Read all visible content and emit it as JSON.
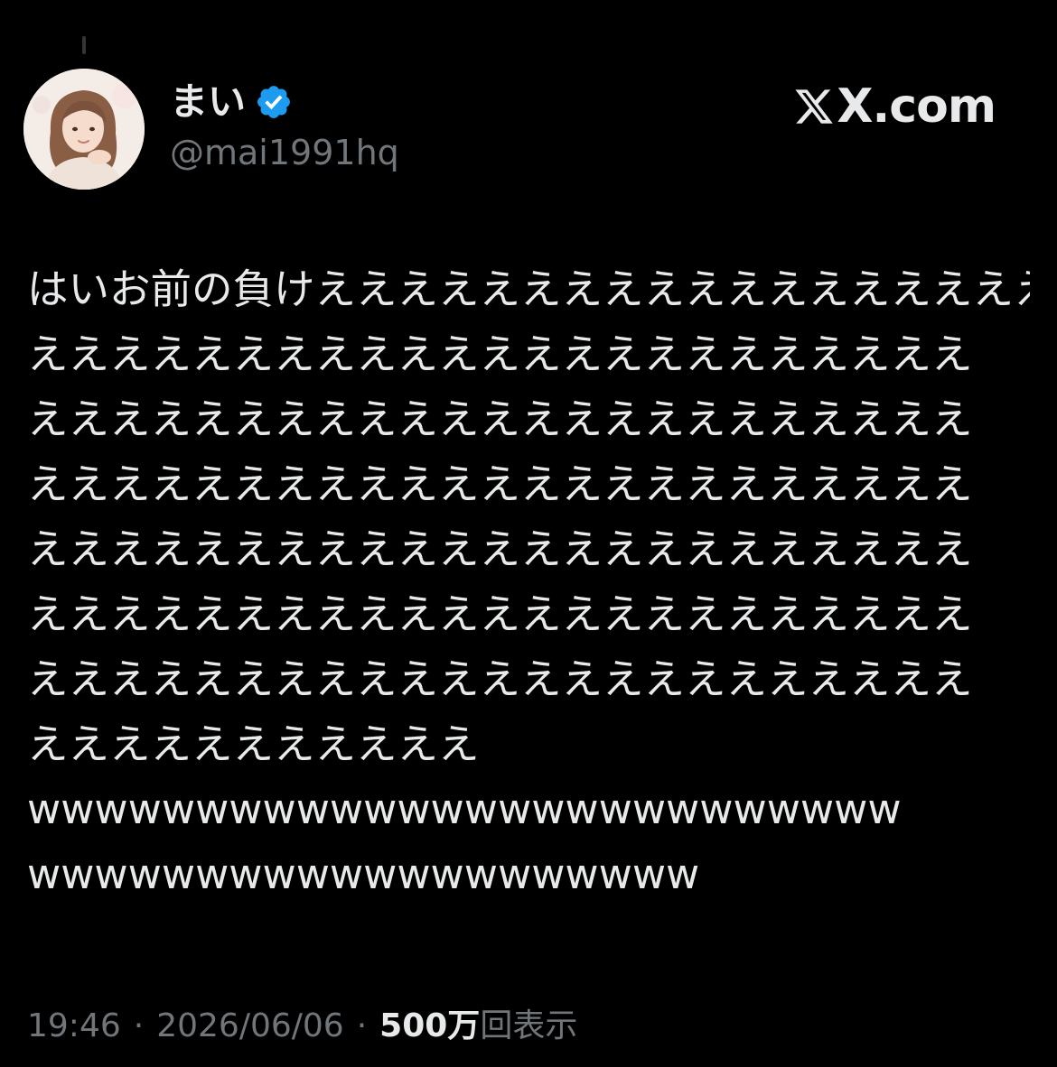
{
  "post": {
    "author": {
      "display_name": "まい",
      "handle": "@mai1991hq",
      "verified": true,
      "verified_icon": "verified-badge-icon",
      "avatar": "avatar-illustration"
    },
    "watermark": "X.com",
    "text_lines": [
      "はいお前の負けえええええええええええええええええええ",
      "えええええええええええええええええええええええ",
      "えええええええええええええええええええええええ",
      "えええええええええええええええええええええええ",
      "えええええええええええええええええええええええ",
      "えええええええええええええええええええええええ",
      "えええええええええええええええええええええええ",
      "えええええええええええ",
      "wwwwwwwwwwwwwwwwwwwwwwwwww",
      "wwwwwwwwwwwwwwwwwwww"
    ],
    "time": "19:46",
    "separator": "·",
    "date": "2026/06/06",
    "views_count": "500万",
    "views_label": "回表示"
  },
  "colors": {
    "background": "#000000",
    "text_primary": "#e7e9ea",
    "text_secondary": "#71767b",
    "verified_blue": "#1d9bf0"
  }
}
